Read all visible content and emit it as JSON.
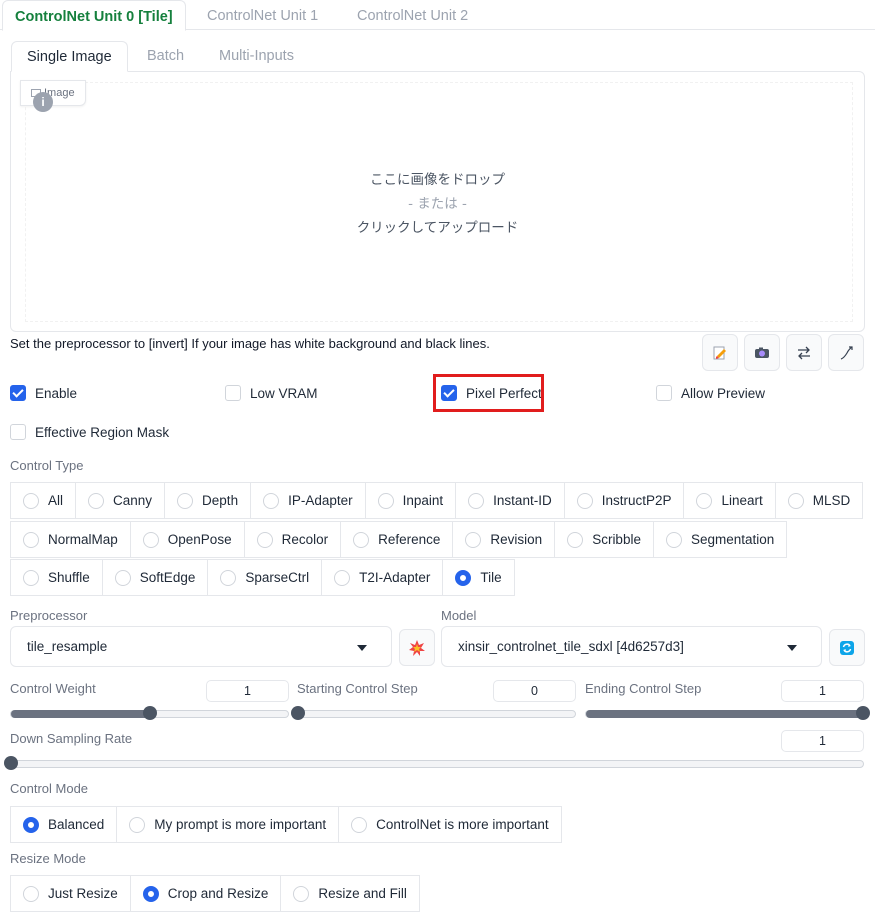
{
  "unit_tabs": [
    "ControlNet Unit 0 [Tile]",
    "ControlNet Unit 1",
    "ControlNet Unit 2"
  ],
  "input_tabs": [
    "Single Image",
    "Batch",
    "Multi-Inputs"
  ],
  "image_panel": {
    "label": "Image",
    "drop_line1": "ここに画像をドロップ",
    "drop_line2": "- または -",
    "drop_line3": "クリックしてアップロード"
  },
  "hint_text": "Set the preprocessor to [invert] If your image has white background and black lines.",
  "tool_icons": [
    "edit-icon",
    "camera-icon",
    "swap-icon",
    "curve-arrow-icon"
  ],
  "checkboxes": {
    "enable": {
      "label": "Enable",
      "checked": true
    },
    "low_vram": {
      "label": "Low VRAM",
      "checked": false
    },
    "pixel_perfect": {
      "label": "Pixel Perfect",
      "checked": true
    },
    "allow_preview": {
      "label": "Allow Preview",
      "checked": false
    },
    "effective_region_mask": {
      "label": "Effective Region Mask",
      "checked": false
    }
  },
  "control_type": {
    "label": "Control Type",
    "rows": [
      [
        "All",
        "Canny",
        "Depth",
        "IP-Adapter",
        "Inpaint",
        "Instant-ID",
        "InstructP2P",
        "Lineart",
        "MLSD"
      ],
      [
        "NormalMap",
        "OpenPose",
        "Recolor",
        "Reference",
        "Revision",
        "Scribble",
        "Segmentation"
      ],
      [
        "Shuffle",
        "SoftEdge",
        "SparseCtrl",
        "T2I-Adapter",
        "Tile"
      ]
    ],
    "selected": "Tile"
  },
  "preprocessor": {
    "label": "Preprocessor",
    "value": "tile_resample"
  },
  "model": {
    "label": "Model",
    "value": "xinsir_controlnet_tile_sdxl [4d6257d3]"
  },
  "sliders": {
    "control_weight": {
      "label": "Control Weight",
      "value": "1",
      "fraction": 0.5
    },
    "starting_step": {
      "label": "Starting Control Step",
      "value": "0",
      "fraction": 0.0
    },
    "ending_step": {
      "label": "Ending Control Step",
      "value": "1",
      "fraction": 1.0
    },
    "down_sampling": {
      "label": "Down Sampling Rate",
      "value": "1",
      "fraction": 0.0
    }
  },
  "control_mode": {
    "label": "Control Mode",
    "options": [
      "Balanced",
      "My prompt is more important",
      "ControlNet is more important"
    ],
    "selected": "Balanced"
  },
  "resize_mode": {
    "label": "Resize Mode",
    "options": [
      "Just Resize",
      "Crop and Resize",
      "Resize and Fill"
    ],
    "selected": "Crop and Resize"
  },
  "colors": {
    "accent": "#2563eb",
    "tab_active": "#15803d",
    "highlight": "#e11d1d"
  }
}
